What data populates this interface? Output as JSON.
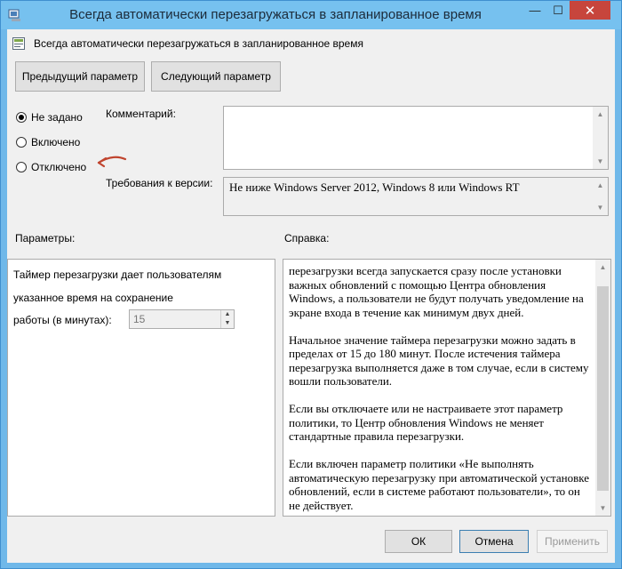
{
  "window": {
    "title": "Всегда автоматически перезагружаться в запланированное время",
    "minimize": "—",
    "maximize": "☐",
    "close": "✕"
  },
  "header": {
    "policy_name": "Всегда автоматически перезагружаться в запланированное время"
  },
  "nav": {
    "prev_label": "Предыдущий параметр",
    "next_label": "Следующий параметр"
  },
  "state": {
    "options": [
      {
        "label": "Не задано",
        "checked": true
      },
      {
        "label": "Включено",
        "checked": false
      },
      {
        "label": "Отключено",
        "checked": false
      }
    ]
  },
  "comment": {
    "label": "Комментарий:",
    "value": ""
  },
  "version": {
    "label": "Требования к версии:",
    "value": "Не ниже Windows Server 2012, Windows 8 или Windows RT"
  },
  "params": {
    "label": "Параметры:",
    "line1": "Таймер перезагрузки дает пользователям",
    "line2": "указанное время на сохранение",
    "line3": "работы (в минутах):",
    "spinner_value": "15"
  },
  "help": {
    "label": "Справка:",
    "paragraphs": [
      "перезагрузки всегда запускается сразу после установки важных обновлений с помощью Центра обновления Windows, а пользователи не будут получать уведомление на экране входа в течение как минимум двух дней.",
      "Начальное значение таймера перезагрузки можно задать в пределах от 15 до 180 минут. После истечения таймера перезагрузка выполняется даже в том случае, если в систему вошли пользователи.",
      "Если вы отключаете или не настраиваете этот параметр политики, то Центр обновления Windows не меняет стандартные правила перезагрузки.",
      "Если включен параметр политики «Не выполнять автоматическую перезагрузку при автоматической установке обновлений, если в системе работают пользователи», то он не действует."
    ]
  },
  "footer": {
    "ok_label": "ОК",
    "cancel_label": "Отмена",
    "apply_label": "Применить"
  },
  "colors": {
    "titlebar": "#76c1ef",
    "client_bg": "#f0f0f0",
    "annotation_arrow": "#c0442e"
  }
}
